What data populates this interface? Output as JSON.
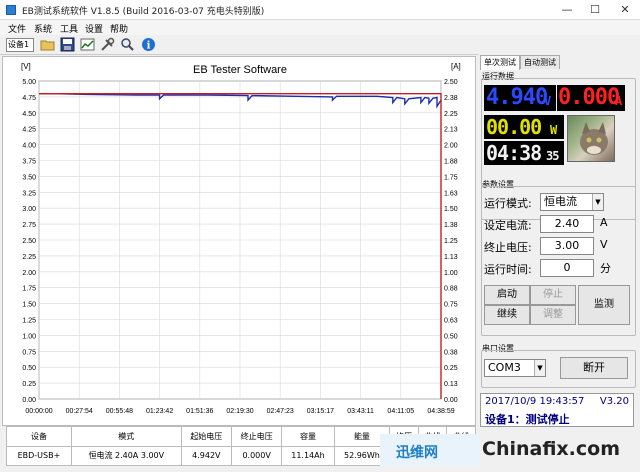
{
  "window": {
    "title": "EB测试系统软件 V1.8.5 (Build 2016-03-07 充电头特别版)",
    "minimize": "—",
    "maximize": "☐",
    "close": "✕"
  },
  "menu": [
    "文件",
    "系统",
    "工具",
    "设置",
    "帮助"
  ],
  "toolbar": {
    "device": "设备1",
    "icons": [
      "folder-icon",
      "save-icon",
      "chart-icon",
      "tools-icon",
      "search-icon",
      "info-icon"
    ]
  },
  "chart_data": {
    "type": "line",
    "title": "EB Tester Software",
    "y_left_label": "[V]",
    "y_right_label": "[A]",
    "y_left_ticks": [
      "5.00",
      "4.75",
      "4.50",
      "4.25",
      "4.00",
      "3.75",
      "3.50",
      "3.25",
      "3.00",
      "2.75",
      "2.50",
      "2.25",
      "2.00",
      "1.75",
      "1.50",
      "1.25",
      "1.00",
      "0.75",
      "0.50",
      "0.25",
      "0.00"
    ],
    "y_right_ticks": [
      "2.50",
      "2.38",
      "2.25",
      "2.13",
      "2.00",
      "1.88",
      "1.75",
      "1.63",
      "1.50",
      "1.38",
      "1.25",
      "1.13",
      "1.00",
      "0.88",
      "0.75",
      "0.63",
      "0.50",
      "0.38",
      "0.25",
      "0.13",
      "0.00"
    ],
    "x_ticks": [
      "00:00:00",
      "00:27:54",
      "00:55:48",
      "01:23:42",
      "01:51:36",
      "02:19:30",
      "02:47:23",
      "03:15:17",
      "03:43:11",
      "04:11:05",
      "04:38:59"
    ],
    "ylim_left": [
      0,
      5
    ],
    "ylim_right": [
      0,
      2.5
    ],
    "grid": true,
    "series": [
      {
        "axis": "left",
        "color": "#1a2fb0",
        "points": [
          [
            0,
            4.8
          ],
          [
            0.04,
            4.8
          ],
          [
            0.12,
            4.79
          ],
          [
            0.24,
            4.78
          ],
          [
            0.3,
            4.78
          ],
          [
            0.3,
            4.72
          ],
          [
            0.31,
            4.78
          ],
          [
            0.42,
            4.78
          ],
          [
            0.52,
            4.77
          ],
          [
            0.52,
            4.7
          ],
          [
            0.53,
            4.77
          ],
          [
            0.64,
            4.76
          ],
          [
            0.73,
            4.75
          ],
          [
            0.73,
            4.7
          ],
          [
            0.74,
            4.76
          ],
          [
            0.84,
            4.76
          ],
          [
            0.88,
            4.74
          ],
          [
            0.88,
            4.66
          ],
          [
            0.89,
            4.74
          ],
          [
            0.91,
            4.72
          ],
          [
            0.91,
            4.64
          ],
          [
            0.92,
            4.72
          ],
          [
            0.95,
            4.74
          ],
          [
            0.95,
            4.66
          ],
          [
            0.96,
            4.74
          ],
          [
            0.97,
            4.73
          ],
          [
            0.97,
            4.65
          ],
          [
            0.98,
            4.73
          ],
          [
            0.99,
            4.74
          ],
          [
            0.99,
            4.6
          ],
          [
            1,
            4.7
          ]
        ]
      },
      {
        "axis": "right",
        "color": "#c81e1e",
        "points": [
          [
            0,
            2.4
          ],
          [
            0.5,
            2.4
          ],
          [
            1,
            2.4
          ],
          [
            1,
            0
          ]
        ]
      }
    ]
  },
  "stats": {
    "headers": [
      "设备",
      "模式",
      "起始电压",
      "终止电压",
      "容量",
      "能量",
      "均压",
      "曲线",
      "曲线"
    ],
    "values": [
      "EBD-USB+",
      "恒电流  2.40A  3.00V",
      "4.942V",
      "0.000V",
      "11.14Ah",
      "52.96Wh",
      "",
      "",
      ""
    ]
  },
  "panel": {
    "tabs": [
      "单次测试",
      "自动测试"
    ],
    "run_data_label": "运行数据",
    "voltage": {
      "value": "4.940",
      "unit": "V",
      "color": "#2a4aff"
    },
    "current": {
      "value": "0.000",
      "unit": "A",
      "color": "#ff2020"
    },
    "power": {
      "value": "00.00",
      "unit": "W",
      "color": "#e0e000"
    },
    "elapsed": {
      "value": "04:38",
      "sec": "35",
      "color": "#f0f0f0"
    },
    "params_label": "参数设置",
    "mode_label": "运行模式:",
    "mode_value": "恒电流",
    "current_label": "设定电流:",
    "current_value": "2.40",
    "current_unit": "A",
    "voltage_label": "终止电压:",
    "voltage_value": "3.00",
    "voltage_unit": "V",
    "time_label": "运行时间:",
    "time_value": "0",
    "time_unit": "分",
    "btn_start": "启动",
    "btn_stop": "停止",
    "btn_continue": "继续",
    "btn_adjust": "调整",
    "btn_monitor": "监测",
    "serial_label": "串口设置",
    "com_value": "COM3",
    "btn_disconnect": "断开",
    "status_time": "2017/10/9 19:43:57",
    "status_version": "V3.20",
    "status_msg": "设备1：测试停止"
  },
  "watermark": {
    "logo": "迅维网",
    "site": "Chinafix.com"
  }
}
